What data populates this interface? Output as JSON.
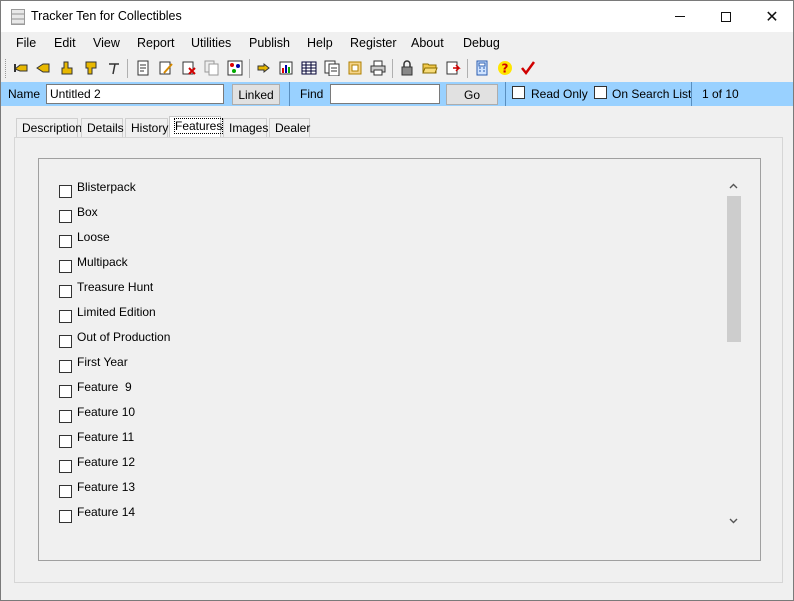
{
  "window": {
    "title": "Tracker Ten for Collectibles",
    "controls": {
      "minimize": "—",
      "maximize": "☐",
      "close": "✕"
    }
  },
  "menu": [
    "File",
    "Edit",
    "View",
    "Report",
    "Utilities",
    "Publish",
    "Help",
    "Register",
    "About",
    "Debug"
  ],
  "toolbar": {
    "icons": [
      "first-record-icon",
      "previous-record-icon",
      "next-record-icon",
      "last-record-icon",
      "go-to-icon",
      "new-record-icon",
      "edit-record-icon",
      "delete-record-icon",
      "copy-record-icon",
      "sort-icon",
      "search-icon",
      "report-icon",
      "table-view-icon",
      "list-view-icon",
      "image-icon",
      "print-icon",
      "lock-icon",
      "open-folder-icon",
      "export-icon",
      "calculator-icon",
      "help-icon",
      "check-icon"
    ]
  },
  "namebar": {
    "name_label": "Name",
    "name_value": "Untitled 2",
    "linked_label": "Linked",
    "find_label": "Find",
    "find_value": "",
    "go_label": "Go",
    "read_only_label": "Read Only",
    "on_search_list_label": "On Search List",
    "record_position": "1 of 10"
  },
  "tabs": [
    {
      "label": "Description",
      "active": false
    },
    {
      "label": "Details",
      "active": false
    },
    {
      "label": "History",
      "active": false
    },
    {
      "label": "Features",
      "active": true
    },
    {
      "label": "Images",
      "active": false
    },
    {
      "label": "Dealer",
      "active": false
    }
  ],
  "features": [
    {
      "label": "Blisterpack",
      "checked": false
    },
    {
      "label": "Box",
      "checked": false
    },
    {
      "label": "Loose",
      "checked": false
    },
    {
      "label": "Multipack",
      "checked": false
    },
    {
      "label": "Treasure Hunt",
      "checked": false
    },
    {
      "label": "Limited Edition",
      "checked": false
    },
    {
      "label": "Out of Production",
      "checked": false
    },
    {
      "label": "First Year",
      "checked": false
    },
    {
      "label": "Feature  9",
      "checked": false
    },
    {
      "label": "Feature 10",
      "checked": false
    },
    {
      "label": "Feature 11",
      "checked": false
    },
    {
      "label": "Feature 12",
      "checked": false
    },
    {
      "label": "Feature 13",
      "checked": false
    },
    {
      "label": "Feature 14",
      "checked": false
    }
  ],
  "colors": {
    "namebar_bg": "#99d1ff",
    "check_red": "#d00000"
  }
}
